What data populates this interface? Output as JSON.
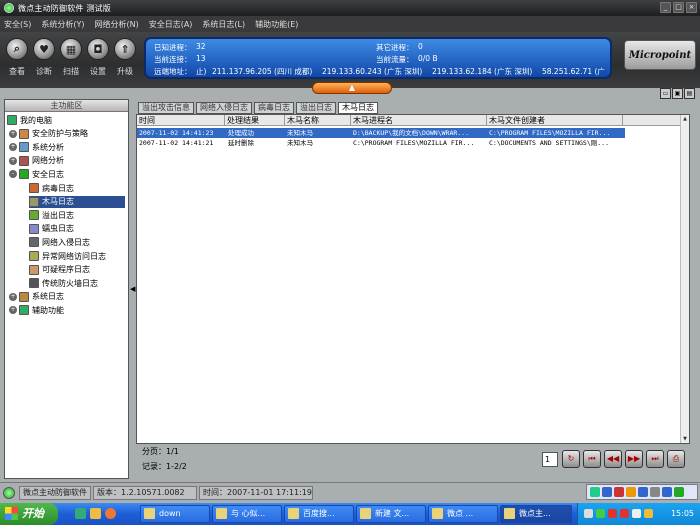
{
  "window": {
    "title": "微点主动防御软件 测试版",
    "controls": [
      "_",
      "□",
      "×"
    ]
  },
  "menu": [
    "安全(S)",
    "系统分析(Y)",
    "网络分析(N)",
    "安全日志(A)",
    "系统日志(L)",
    "辅助功能(E)"
  ],
  "toolbar": {
    "buttons": [
      {
        "label": "查看",
        "icon": "magnifier-icon"
      },
      {
        "label": "诊断",
        "icon": "heart-icon"
      },
      {
        "label": "扫描",
        "icon": "scan-icon"
      },
      {
        "label": "设置",
        "icon": "settings-icon"
      },
      {
        "label": "升级",
        "icon": "upgrade-icon"
      }
    ]
  },
  "status_panel": {
    "known_processes_label": "已知进程：",
    "known_processes_value": "32",
    "other_processes_label": "其它进程：",
    "other_processes_value": "0",
    "current_connections_label": "当前连接：",
    "current_connections_value": "13",
    "current_traffic_label": "当前流量：",
    "current_traffic_value": "0/0 B",
    "remote_address_label": "远端地址：",
    "remote_address_prefix": "止)",
    "remote_addresses": [
      "211.137.96.205 (四川 成都)",
      "219.133.60.243 (广东 深圳)",
      "219.133.62.184 (广东 深圳)",
      "58.251.62.71 (广"
    ],
    "logo_text": "Micropoint"
  },
  "left_panel": {
    "title": "主功能区",
    "tree": [
      {
        "label": "我的电脑",
        "level": 0,
        "expander": "",
        "selected": false
      },
      {
        "label": "安全防护与策略",
        "level": 1,
        "expander": "+"
      },
      {
        "label": "系统分析",
        "level": 1,
        "expander": "+"
      },
      {
        "label": "网络分析",
        "level": 1,
        "expander": "+"
      },
      {
        "label": "安全日志",
        "level": 1,
        "expander": "-"
      },
      {
        "label": "病毒日志",
        "level": 2
      },
      {
        "label": "木马日志",
        "level": 2,
        "selected": true
      },
      {
        "label": "溢出日志",
        "level": 2
      },
      {
        "label": "蠕虫日志",
        "level": 2
      },
      {
        "label": "网络入侵日志",
        "level": 2
      },
      {
        "label": "异常网络访问日志",
        "level": 2
      },
      {
        "label": "可疑程序日志",
        "level": 2
      },
      {
        "label": "传统防火墙日志",
        "level": 2
      },
      {
        "label": "系统日志",
        "level": 1,
        "expander": "+"
      },
      {
        "label": "辅助功能",
        "level": 1,
        "expander": "+"
      }
    ]
  },
  "tabs": [
    {
      "label": "溢出攻击信息",
      "active": false
    },
    {
      "label": "网络入侵日志",
      "active": false
    },
    {
      "label": "病毒日志",
      "active": false
    },
    {
      "label": "溢出日志",
      "active": false
    },
    {
      "label": "木马日志",
      "active": true
    }
  ],
  "table": {
    "columns": [
      "时间",
      "处理结果",
      "木马名称",
      "木马进程名",
      "木马文件创建者"
    ],
    "rows": [
      {
        "time": "2007-11-02 14:41:23",
        "result": "处理成功",
        "name": "未知木马",
        "process": "D:\\BACKUP\\我的文档\\DOWN\\WRAR...",
        "creator": "C:\\PROGRAM FILES\\MOZILLA FIR...",
        "selected": true
      },
      {
        "time": "2007-11-02 14:41:21",
        "result": "延时删除",
        "name": "未知木马",
        "process": "C:\\PROGRAM FILES\\MOZILLA FIR...",
        "creator": "C:\\DOCUMENTS AND SETTINGS\\刚...",
        "selected": false
      }
    ]
  },
  "pager": {
    "page_label": "分页：1/1",
    "records_label": "记录：1-2/2",
    "page_input": "1"
  },
  "app_status": {
    "app_name": "微点主动防御软件",
    "version": "版本：1.2.10571.0082",
    "time": "时间：2007-11-01 17:11:19"
  },
  "taskbar": {
    "start_label": "开始",
    "buttons": [
      {
        "label": "down",
        "active": false
      },
      {
        "label": "与 心似...",
        "active": false
      },
      {
        "label": "百度搜...",
        "active": false
      },
      {
        "label": "新建 文...",
        "active": false
      },
      {
        "label": "微点 ...",
        "active": false
      },
      {
        "label": "微点主...",
        "active": true
      }
    ],
    "clock": "15:05"
  }
}
